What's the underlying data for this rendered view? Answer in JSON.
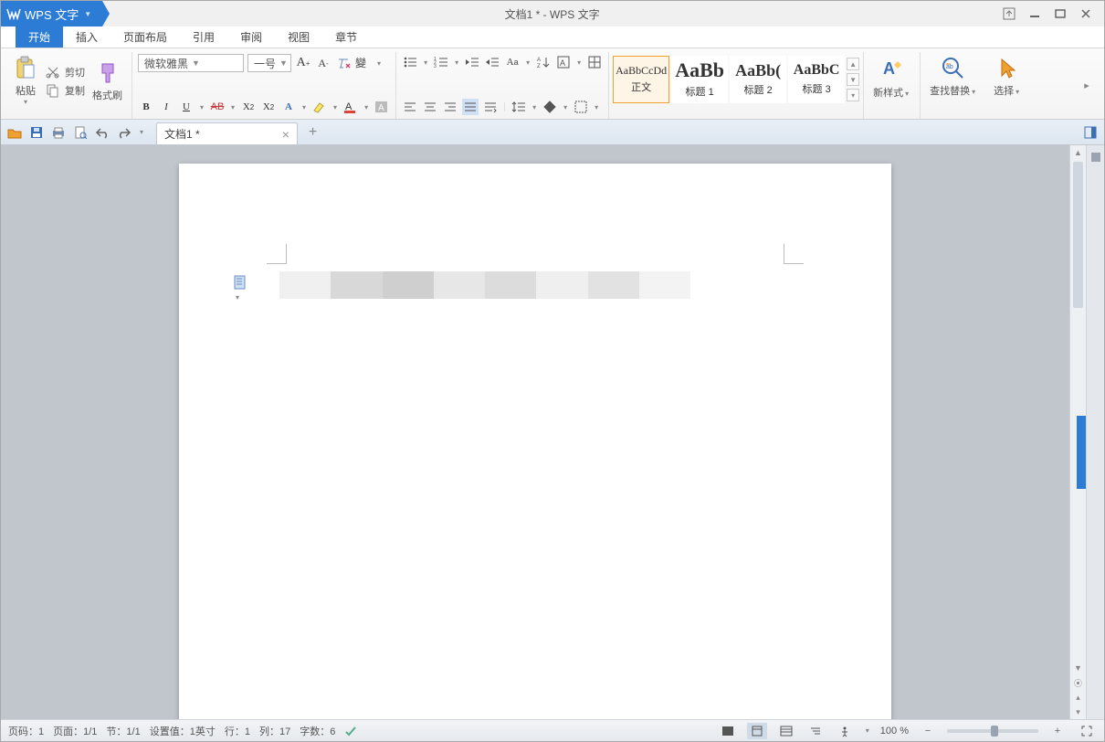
{
  "app": {
    "name": "WPS 文字",
    "title": "文档1 * - WPS 文字"
  },
  "menu": {
    "tabs": [
      "开始",
      "插入",
      "页面布局",
      "引用",
      "审阅",
      "视图",
      "章节"
    ],
    "active": 0
  },
  "ribbon": {
    "paste": "粘贴",
    "cut": "剪切",
    "copy": "复制",
    "format_painter": "格式刷",
    "font_name": "微软雅黑",
    "font_size": "一号",
    "styles": [
      {
        "preview": "AaBbCcDd",
        "name": "正文",
        "small": true
      },
      {
        "preview": "AaBb",
        "name": "标题 1"
      },
      {
        "preview": "AaBb(",
        "name": "标题 2"
      },
      {
        "preview": "AaBbC",
        "name": "标题 3"
      }
    ],
    "new_style": "新样式",
    "find_replace": "查找替换",
    "select": "选择"
  },
  "tabs": {
    "doc1": "文档1 *"
  },
  "status": {
    "page_no": "页码：1",
    "page": "页面：1/1",
    "section": "节：1/1",
    "setting": "设置值：1英寸",
    "row": "行：1",
    "col": "列：17",
    "words": "字数：6",
    "zoom": "100 %"
  }
}
